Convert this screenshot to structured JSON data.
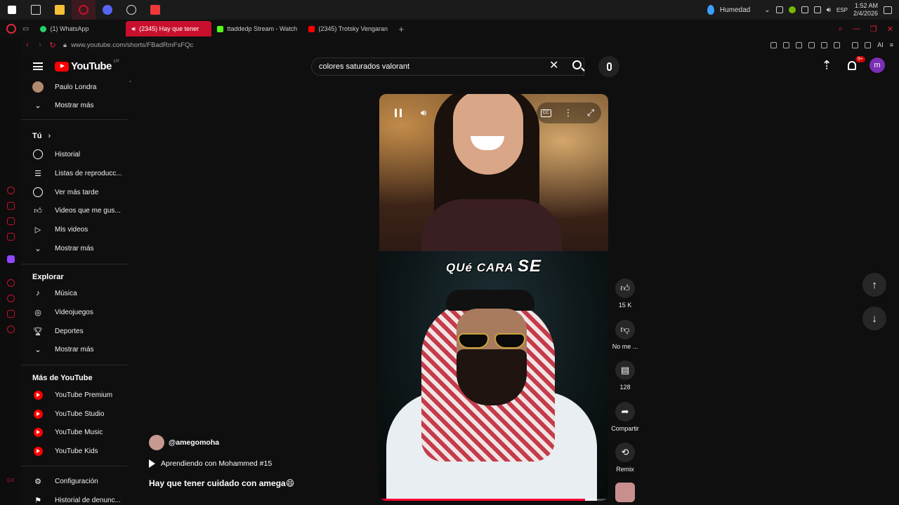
{
  "taskbar": {
    "weather": "Humedad",
    "lang": "ESP",
    "time": "1:52 AM",
    "date": "2/4/2026"
  },
  "browser": {
    "tabs": [
      {
        "label": "(1) WhatsApp",
        "color": "#25d366"
      },
      {
        "label": "(2345) Hay que tener",
        "color": "#ff0000"
      },
      {
        "label": "ttaddedp Stream - Watch",
        "color": "#53fc18"
      },
      {
        "label": "(2345) Trotsky Vengaran",
        "color": "#ff0000"
      }
    ],
    "url": "www.youtube.com/shorts/FBadRmFsFQc",
    "tab_plus": "+"
  },
  "header": {
    "logo": "YouTube",
    "country": "UY",
    "search_value": "colores saturados valorant",
    "notif_badge": "9+",
    "avatar_letter": "m"
  },
  "sidebar": {
    "subscription": "Paulo Londra",
    "more1": "Mostrar más",
    "you_heading": "Tú",
    "you_items": [
      "Historial",
      "Listas de reproducc...",
      "Ver más tarde",
      "Videos que me gus...",
      "Mis videos"
    ],
    "more2": "Mostrar más",
    "explore_heading": "Explorar",
    "explore_items": [
      "Música",
      "Videojuegos",
      "Deportes"
    ],
    "more3": "Mostrar más",
    "more_yt_heading": "Más de YouTube",
    "more_yt_items": [
      "YouTube Premium",
      "YouTube Studio",
      "YouTube Music",
      "YouTube Kids"
    ],
    "settings": "Configuración",
    "report_history": "Historial de denunc..."
  },
  "video": {
    "caption_a": "QUé CARA",
    "caption_b": "SE",
    "progress": 0.9
  },
  "actions": {
    "likes": "15 K",
    "dislike": "No me ...",
    "comments": "128",
    "share": "Compartir",
    "remix": "Remix"
  },
  "meta": {
    "channel": "@amegomoha",
    "playlist": "Aprendiendo con Mohammed #15",
    "title": "Hay que tener cuidado con amega😄"
  },
  "colors": {
    "accent": "#ff0000",
    "opera_red": "#c8102e",
    "background": "#0f0f0f"
  }
}
